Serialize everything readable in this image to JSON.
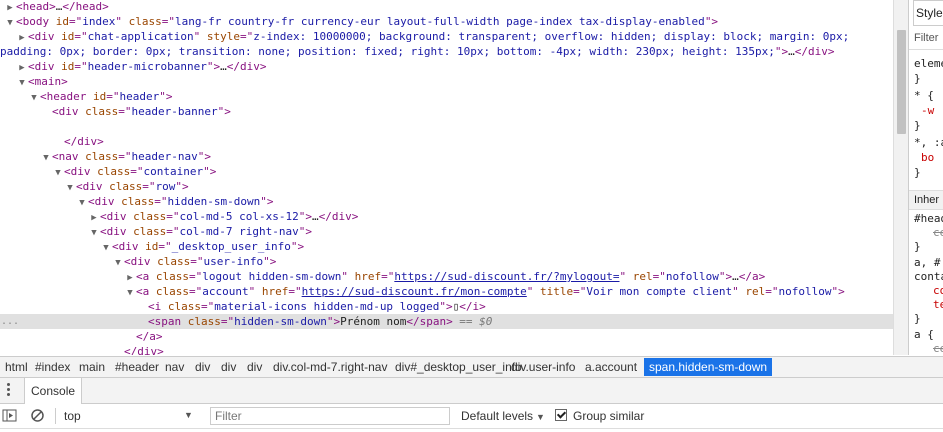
{
  "elements": {
    "lines": [
      {
        "indent": 0,
        "tri": "▶",
        "parts": [
          [
            "tag",
            "<head>"
          ],
          [
            "txt",
            "…"
          ],
          [
            "tag",
            "</head>"
          ]
        ]
      },
      {
        "indent": 0,
        "tri": "▼",
        "parts": [
          [
            "tag",
            "<body "
          ],
          [
            "an",
            "id"
          ],
          [
            "tag",
            "=\""
          ],
          [
            "av",
            "index"
          ],
          [
            "tag",
            "\" "
          ],
          [
            "an",
            "class"
          ],
          [
            "tag",
            "=\""
          ],
          [
            "av",
            "lang-fr country-fr currency-eur layout-full-width page-index tax-display-enabled"
          ],
          [
            "tag",
            "\">"
          ]
        ]
      },
      {
        "indent": 1,
        "tri": "▶",
        "parts": [
          [
            "tag",
            "<div "
          ],
          [
            "an",
            "id"
          ],
          [
            "tag",
            "=\""
          ],
          [
            "av",
            "chat-application"
          ],
          [
            "tag",
            "\" "
          ],
          [
            "an",
            "style"
          ],
          [
            "tag",
            "=\""
          ],
          [
            "av",
            "z-index: 10000000; background: transparent; overflow: hidden; display: block; margin: 0px;"
          ]
        ]
      },
      {
        "indent": 0,
        "tri": "",
        "parts": [
          [
            "av",
            "padding: 0px; border: 0px; transition: none; position: fixed; right: 10px; bottom: -4px; width: 230px; height: 135px;"
          ],
          [
            "tag",
            "\">"
          ],
          [
            "txt",
            "…"
          ],
          [
            "tag",
            "</div>"
          ]
        ]
      },
      {
        "indent": 1,
        "tri": "▶",
        "parts": [
          [
            "tag",
            "<div "
          ],
          [
            "an",
            "id"
          ],
          [
            "tag",
            "=\""
          ],
          [
            "av",
            "header-microbanner"
          ],
          [
            "tag",
            "\">"
          ],
          [
            "txt",
            "…"
          ],
          [
            "tag",
            "</div>"
          ]
        ]
      },
      {
        "indent": 1,
        "tri": "▼",
        "parts": [
          [
            "tag",
            "<main>"
          ]
        ]
      },
      {
        "indent": 2,
        "tri": "▼",
        "parts": [
          [
            "tag",
            "<header "
          ],
          [
            "an",
            "id"
          ],
          [
            "tag",
            "=\""
          ],
          [
            "av",
            "header"
          ],
          [
            "tag",
            "\">"
          ]
        ]
      },
      {
        "indent": 3,
        "tri": "",
        "parts": [
          [
            "tag",
            "<div "
          ],
          [
            "an",
            "class"
          ],
          [
            "tag",
            "=\""
          ],
          [
            "av",
            "header-banner"
          ],
          [
            "tag",
            "\">"
          ]
        ]
      },
      {
        "indent": 3,
        "tri": "",
        "parts": [
          [
            "txt",
            ""
          ]
        ]
      },
      {
        "indent": 4,
        "tri": "",
        "parts": [
          [
            "tag",
            "</div>"
          ]
        ]
      },
      {
        "indent": 3,
        "tri": "▼",
        "parts": [
          [
            "tag",
            "<nav "
          ],
          [
            "an",
            "class"
          ],
          [
            "tag",
            "=\""
          ],
          [
            "av",
            "header-nav"
          ],
          [
            "tag",
            "\">"
          ]
        ]
      },
      {
        "indent": 4,
        "tri": "▼",
        "parts": [
          [
            "tag",
            "<div "
          ],
          [
            "an",
            "class"
          ],
          [
            "tag",
            "=\""
          ],
          [
            "av",
            "container"
          ],
          [
            "tag",
            "\">"
          ]
        ]
      },
      {
        "indent": 5,
        "tri": "▼",
        "parts": [
          [
            "tag",
            "<div "
          ],
          [
            "an",
            "class"
          ],
          [
            "tag",
            "=\""
          ],
          [
            "av",
            "row"
          ],
          [
            "tag",
            "\">"
          ]
        ]
      },
      {
        "indent": 6,
        "tri": "▼",
        "parts": [
          [
            "tag",
            "<div "
          ],
          [
            "an",
            "class"
          ],
          [
            "tag",
            "=\""
          ],
          [
            "av",
            "hidden-sm-down"
          ],
          [
            "tag",
            "\">"
          ]
        ]
      },
      {
        "indent": 7,
        "tri": "▶",
        "parts": [
          [
            "tag",
            "<div "
          ],
          [
            "an",
            "class"
          ],
          [
            "tag",
            "=\""
          ],
          [
            "av",
            "col-md-5 col-xs-12"
          ],
          [
            "tag",
            "\">"
          ],
          [
            "txt",
            "…"
          ],
          [
            "tag",
            "</div>"
          ]
        ]
      },
      {
        "indent": 7,
        "tri": "▼",
        "parts": [
          [
            "tag",
            "<div "
          ],
          [
            "an",
            "class"
          ],
          [
            "tag",
            "=\""
          ],
          [
            "av",
            "col-md-7 right-nav"
          ],
          [
            "tag",
            "\">"
          ]
        ]
      },
      {
        "indent": 8,
        "tri": "▼",
        "parts": [
          [
            "tag",
            "<div "
          ],
          [
            "an",
            "id"
          ],
          [
            "tag",
            "=\""
          ],
          [
            "av",
            "_desktop_user_info"
          ],
          [
            "tag",
            "\">"
          ]
        ]
      },
      {
        "indent": 9,
        "tri": "▼",
        "parts": [
          [
            "tag",
            "<div "
          ],
          [
            "an",
            "class"
          ],
          [
            "tag",
            "=\""
          ],
          [
            "av",
            "user-info"
          ],
          [
            "tag",
            "\">"
          ]
        ]
      },
      {
        "indent": 10,
        "tri": "▶",
        "parts": [
          [
            "tag",
            "<a "
          ],
          [
            "an",
            "class"
          ],
          [
            "tag",
            "=\""
          ],
          [
            "av",
            "logout hidden-sm-down"
          ],
          [
            "tag",
            "\" "
          ],
          [
            "an",
            "href"
          ],
          [
            "tag",
            "=\""
          ],
          [
            "lnk",
            "https://sud-discount.fr/?mylogout="
          ],
          [
            "tag",
            "\" "
          ],
          [
            "an",
            "rel"
          ],
          [
            "tag",
            "=\""
          ],
          [
            "av",
            "nofollow"
          ],
          [
            "tag",
            "\">"
          ],
          [
            "txt",
            "…"
          ],
          [
            "tag",
            "</a>"
          ]
        ]
      },
      {
        "indent": 10,
        "tri": "▼",
        "parts": [
          [
            "tag",
            "<a "
          ],
          [
            "an",
            "class"
          ],
          [
            "tag",
            "=\""
          ],
          [
            "av",
            "account"
          ],
          [
            "tag",
            "\" "
          ],
          [
            "an",
            "href"
          ],
          [
            "tag",
            "=\""
          ],
          [
            "lnk",
            "https://sud-discount.fr/mon-compte"
          ],
          [
            "tag",
            "\" "
          ],
          [
            "an",
            "title"
          ],
          [
            "tag",
            "=\""
          ],
          [
            "av",
            "Voir mon compte client"
          ],
          [
            "tag",
            "\" "
          ],
          [
            "an",
            "rel"
          ],
          [
            "tag",
            "=\""
          ],
          [
            "av",
            "nofollow"
          ],
          [
            "tag",
            "\">"
          ]
        ]
      },
      {
        "indent": 11,
        "tri": "",
        "parts": [
          [
            "tag",
            "<i "
          ],
          [
            "an",
            "class"
          ],
          [
            "tag",
            "=\""
          ],
          [
            "av",
            "material-icons hidden-md-up logged"
          ],
          [
            "tag",
            "\">"
          ],
          [
            "txt",
            "▯"
          ],
          [
            "tag",
            "</i>"
          ]
        ]
      },
      {
        "indent": 11,
        "tri": "",
        "selected": true,
        "parts": [
          [
            "tag",
            "<span "
          ],
          [
            "an",
            "class"
          ],
          [
            "tag",
            "=\""
          ],
          [
            "av",
            "hidden-sm-down"
          ],
          [
            "tag",
            "\">"
          ],
          [
            "txt",
            "Prénom nom"
          ],
          [
            "tag",
            "</span>"
          ],
          [
            "eq",
            " == $0"
          ]
        ]
      },
      {
        "indent": 10,
        "tri": "",
        "parts": [
          [
            "tag",
            "</a>"
          ]
        ]
      },
      {
        "indent": 9,
        "tri": "",
        "parts": [
          [
            "tag",
            "</div>"
          ]
        ]
      }
    ],
    "selected_marker": "..."
  },
  "styles": {
    "tab_label": "Style",
    "filter_label": "Filter",
    "rules": [
      "eleme",
      "}",
      "* {",
      "-w",
      "}",
      "*, :a",
      "bo",
      "}"
    ],
    "inherited_label": "Inher",
    "rules2": [
      "#head",
      "ce",
      "}",
      "a, #",
      "conta",
      "co",
      "te",
      "}",
      "a {",
      "ce"
    ]
  },
  "breadcrumbs": [
    "html",
    "#index",
    "main",
    "#header",
    "nav",
    "div",
    "div",
    "div",
    "div.col-md-7.right-nav",
    "div#_desktop_user_info",
    "div.user-info",
    "a.account",
    "span.hidden-sm-down"
  ],
  "console": {
    "tab_label": "Console",
    "context": "top",
    "filter_placeholder": "Filter",
    "levels_label": "Default levels",
    "group_similar_label": "Group similar"
  }
}
